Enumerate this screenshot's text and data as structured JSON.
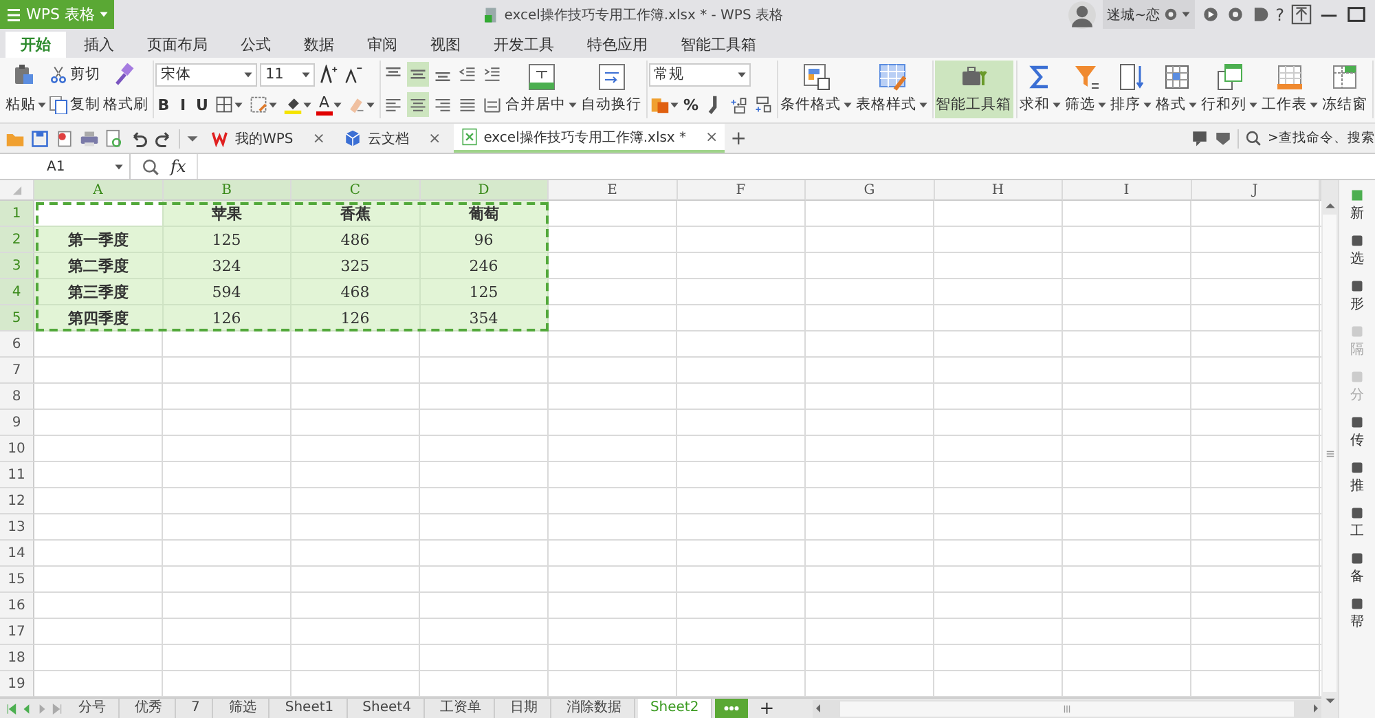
{
  "title_bar": {
    "app_button": "WPS 表格",
    "title": "excel操作技巧专用工作簿.xlsx * - WPS 表格",
    "user": "迷城~恋",
    "help": "?"
  },
  "menu_tabs": [
    {
      "label": "开始",
      "selected": true
    },
    {
      "label": "插入",
      "selected": false
    },
    {
      "label": "页面布局",
      "selected": false
    },
    {
      "label": "公式",
      "selected": false
    },
    {
      "label": "数据",
      "selected": false
    },
    {
      "label": "审阅",
      "selected": false
    },
    {
      "label": "视图",
      "selected": false
    },
    {
      "label": "开发工具",
      "selected": false
    },
    {
      "label": "特色应用",
      "selected": false
    },
    {
      "label": "智能工具箱",
      "selected": false
    }
  ],
  "ribbon": [
    {
      "items": [
        {
          "kind": "large",
          "label": "粘贴",
          "dropdown": true,
          "selected": false
        },
        {
          "kind": "stack",
          "top": [
            {
              "kind": "small",
              "label": "剪切"
            }
          ],
          "bottom": [
            {
              "kind": "small",
              "label": "复制"
            }
          ]
        },
        {
          "kind": "large",
          "label": "格式刷",
          "dropdown": false,
          "selected": false
        }
      ]
    },
    {
      "items": [
        {
          "kind": "stack",
          "top": [
            {
              "kind": "select",
              "value": "宋体",
              "wide": true
            },
            {
              "kind": "select",
              "value": "11",
              "wide": false
            },
            {
              "kind": "icon",
              "dropdown": false,
              "selected": false
            },
            {
              "kind": "icon",
              "dropdown": false,
              "selected": false
            }
          ],
          "bottom": [
            {
              "kind": "text",
              "label": "B"
            },
            {
              "kind": "text",
              "label": "I"
            },
            {
              "kind": "text",
              "label": "U"
            },
            {
              "kind": "icon",
              "dropdown": true,
              "selected": false
            },
            {
              "kind": "icon",
              "dropdown": true,
              "selected": false
            },
            {
              "kind": "icon",
              "dropdown": true,
              "selected": false
            },
            {
              "kind": "fontcolor",
              "label": "A",
              "dropdown": true
            },
            {
              "kind": "icon",
              "dropdown": true,
              "selected": false
            }
          ]
        }
      ]
    },
    {
      "items": [
        {
          "kind": "stack",
          "top": [
            {
              "kind": "icon",
              "dropdown": false,
              "selected": false
            },
            {
              "kind": "icon",
              "dropdown": false,
              "selected": true
            },
            {
              "kind": "icon",
              "dropdown": false,
              "selected": false
            },
            {
              "kind": "icon",
              "dropdown": false,
              "selected": false
            },
            {
              "kind": "icon",
              "dropdown": false,
              "selected": false
            }
          ],
          "bottom": [
            {
              "kind": "icon",
              "dropdown": false,
              "selected": false
            },
            {
              "kind": "icon",
              "dropdown": false,
              "selected": true
            },
            {
              "kind": "icon",
              "dropdown": false,
              "selected": false
            },
            {
              "kind": "icon",
              "dropdown": false,
              "selected": false
            },
            {
              "kind": "icon",
              "dropdown": false,
              "selected": false
            }
          ]
        },
        {
          "kind": "large",
          "label": "合并居中",
          "dropdown": true,
          "selected": false
        },
        {
          "kind": "large",
          "label": "自动换行",
          "dropdown": false,
          "selected": false
        }
      ]
    },
    {
      "items": [
        {
          "kind": "stack",
          "top": [
            {
              "kind": "select",
              "value": "常规",
              "wide": true
            }
          ],
          "bottom": [
            {
              "kind": "icon",
              "dropdown": true,
              "selected": false
            },
            {
              "kind": "text",
              "label": "%"
            },
            {
              "kind": "icon",
              "dropdown": false,
              "selected": false
            },
            {
              "kind": "icon",
              "dropdown": false,
              "selected": false
            },
            {
              "kind": "icon",
              "dropdown": false,
              "selected": false
            }
          ]
        }
      ]
    },
    {
      "items": [
        {
          "kind": "large",
          "label": "条件格式",
          "dropdown": true,
          "selected": false
        },
        {
          "kind": "large",
          "label": "表格样式",
          "dropdown": true,
          "selected": false
        }
      ]
    },
    {
      "items": [
        {
          "kind": "large",
          "label": "智能工具箱",
          "dropdown": false,
          "selected": true
        }
      ]
    },
    {
      "items": [
        {
          "kind": "large",
          "label": "求和",
          "dropdown": true,
          "selected": false
        },
        {
          "kind": "large",
          "label": "筛选",
          "dropdown": true,
          "selected": false
        },
        {
          "kind": "large",
          "label": "排序",
          "dropdown": true,
          "selected": false
        },
        {
          "kind": "large",
          "label": "格式",
          "dropdown": true,
          "selected": false
        },
        {
          "kind": "large",
          "label": "行和列",
          "dropdown": true,
          "selected": false
        },
        {
          "kind": "large",
          "label": "工作表",
          "dropdown": true,
          "selected": false
        },
        {
          "kind": "large",
          "label": "冻结窗",
          "dropdown": false,
          "selected": false
        }
      ]
    }
  ],
  "doc_tabs": [
    {
      "label": "我的WPS",
      "close": "×",
      "selected": false
    },
    {
      "label": "云文档",
      "close": "×",
      "selected": false
    },
    {
      "label": "excel操作技巧专用工作簿.xlsx *",
      "close": "×",
      "selected": true
    }
  ],
  "new_tab": "+",
  "command_search": ">查找命令、搜索",
  "name_box": "A1",
  "formula_label": "fx",
  "columns": [
    {
      "label": "A",
      "selected": true
    },
    {
      "label": "B",
      "selected": true
    },
    {
      "label": "C",
      "selected": true
    },
    {
      "label": "D",
      "selected": true
    },
    {
      "label": "E",
      "selected": false
    },
    {
      "label": "F",
      "selected": false
    },
    {
      "label": "G",
      "selected": false
    },
    {
      "label": "H",
      "selected": false
    },
    {
      "label": "I",
      "selected": false
    },
    {
      "label": "J",
      "selected": false
    }
  ],
  "rows": [
    {
      "label": "1",
      "selected": true,
      "cells": [
        {
          "active": true
        },
        {
          "text": "苹果",
          "bold": true,
          "active": false
        },
        {
          "text": "香蕉",
          "bold": true,
          "active": false
        },
        {
          "text": "葡萄",
          "bold": true,
          "active": false
        }
      ]
    },
    {
      "label": "2",
      "selected": true,
      "cells": [
        {
          "text": "第一季度",
          "bold": true,
          "active": false
        },
        {
          "text": "125",
          "bold": false,
          "active": false
        },
        {
          "text": "486",
          "bold": false,
          "active": false
        },
        {
          "text": "96",
          "bold": false,
          "active": false
        }
      ]
    },
    {
      "label": "3",
      "selected": true,
      "cells": [
        {
          "text": "第二季度",
          "bold": true,
          "active": false
        },
        {
          "text": "324",
          "bold": false,
          "active": false
        },
        {
          "text": "325",
          "bold": false,
          "active": false
        },
        {
          "text": "246",
          "bold": false,
          "active": false
        }
      ]
    },
    {
      "label": "4",
      "selected": true,
      "cells": [
        {
          "text": "第三季度",
          "bold": true,
          "active": false
        },
        {
          "text": "594",
          "bold": false,
          "active": false
        },
        {
          "text": "468",
          "bold": false,
          "active": false
        },
        {
          "text": "125",
          "bold": false,
          "active": false
        }
      ]
    },
    {
      "label": "5",
      "selected": true,
      "cells": [
        {
          "text": "第四季度",
          "bold": true,
          "active": false
        },
        {
          "text": "126",
          "bold": false,
          "active": false
        },
        {
          "text": "126",
          "bold": false,
          "active": false
        },
        {
          "text": "354",
          "bold": false,
          "active": false
        }
      ]
    },
    {
      "label": "6",
      "selected": false
    },
    {
      "label": "7",
      "selected": false
    },
    {
      "label": "8",
      "selected": false
    },
    {
      "label": "9",
      "selected": false
    },
    {
      "label": "10",
      "selected": false
    },
    {
      "label": "11",
      "selected": false
    },
    {
      "label": "12",
      "selected": false
    },
    {
      "label": "13",
      "selected": false
    },
    {
      "label": "14",
      "selected": false
    },
    {
      "label": "15",
      "selected": false
    },
    {
      "label": "16",
      "selected": false
    },
    {
      "label": "17",
      "selected": false
    },
    {
      "label": "18",
      "selected": false
    },
    {
      "label": "19",
      "selected": false
    }
  ],
  "side_panel": [
    {
      "label": "新",
      "disabled": false
    },
    {
      "label": "选",
      "disabled": false
    },
    {
      "label": "形",
      "disabled": false
    },
    {
      "label": "隔",
      "disabled": true
    },
    {
      "label": "分",
      "disabled": true
    },
    {
      "label": "传",
      "disabled": false
    },
    {
      "label": "推",
      "disabled": false
    },
    {
      "label": "工",
      "disabled": false
    },
    {
      "label": "备",
      "disabled": false
    },
    {
      "label": "帮",
      "disabled": false
    }
  ],
  "sheet_tabs": [
    {
      "label": "分号",
      "selected": false
    },
    {
      "label": "优秀",
      "selected": false
    },
    {
      "label": "7",
      "selected": false
    },
    {
      "label": "筛选",
      "selected": false
    },
    {
      "label": "Sheet1",
      "selected": false
    },
    {
      "label": "Sheet4",
      "selected": false
    },
    {
      "label": "工资单",
      "selected": false
    },
    {
      "label": "日期",
      "selected": false
    },
    {
      "label": "消除数据",
      "selected": false
    },
    {
      "label": "Sheet2",
      "selected": true
    }
  ],
  "add_sheet": "+"
}
